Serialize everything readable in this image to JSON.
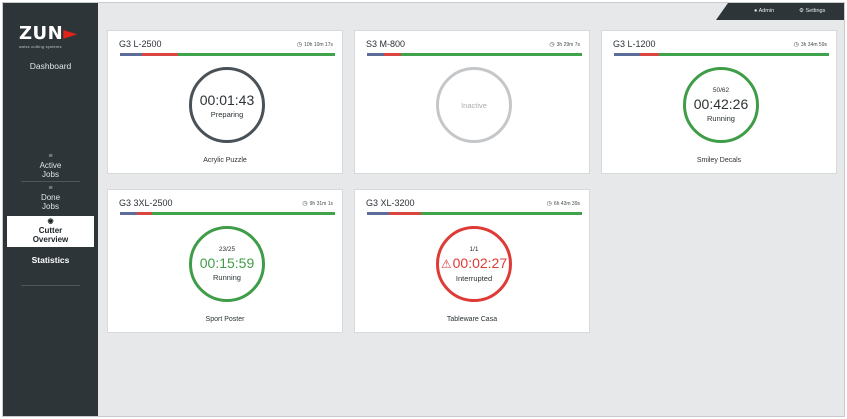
{
  "brand": {
    "name": "ZUND",
    "tagline": "swiss cutting systems"
  },
  "sidebar": {
    "dashboard": "Dashboard",
    "items": [
      {
        "line1": "Active",
        "line2": "Jobs",
        "icon": "list-icon"
      },
      {
        "line1": "Done",
        "line2": "Jobs",
        "icon": "list-icon"
      },
      {
        "line1": "Cutter",
        "line2": "Overview",
        "icon": "cutter-icon"
      }
    ],
    "statistics": "Statistics"
  },
  "topbar": {
    "admin": "Admin",
    "settings": "Settings"
  },
  "colors": {
    "sidebar": "#2e3538",
    "running": "#3f9d48",
    "interrupted": "#de3b36",
    "preparing": "#4a5257",
    "inactive": "#c4c7ca",
    "progress_blue": "#5b6d98",
    "progress_red": "#d9463f",
    "progress_green": "#3fa34d"
  },
  "cards": [
    {
      "machine": "G3 L-2500",
      "duration": "10h 10m 17s",
      "count": "",
      "timer": "00:01:43",
      "status": "Preparing",
      "job": "Acrylic Puzzle",
      "progress": {
        "blue": 0.1,
        "red": 0.17
      }
    },
    {
      "machine": "S3 M-800",
      "duration": "3h 29m 7s",
      "count": "",
      "timer": "",
      "status": "Inactive",
      "job": "",
      "progress": {
        "blue": 0.08,
        "red": 0.08
      }
    },
    {
      "machine": "G3 L-1200",
      "duration": "3h 34m 59s",
      "count": "50/62",
      "timer": "00:42:26",
      "status": "Running",
      "job": "Smiley Decals",
      "progress": {
        "blue": 0.12,
        "red": 0.09
      }
    },
    {
      "machine": "G3 3XL-2500",
      "duration": "9h 31m 1s",
      "count": "23/25",
      "timer": "00:15:59",
      "status": "Running",
      "job": "Sport Poster",
      "progress": {
        "blue": 0.08,
        "red": 0.07
      }
    },
    {
      "machine": "G3 XL-3200",
      "duration": "6h 43m 39s",
      "count": "1/1",
      "timer": "00:02:27",
      "status": "Interrupted",
      "job": "Tableware Casa",
      "progress": {
        "blue": 0.1,
        "red": 0.15
      }
    }
  ]
}
